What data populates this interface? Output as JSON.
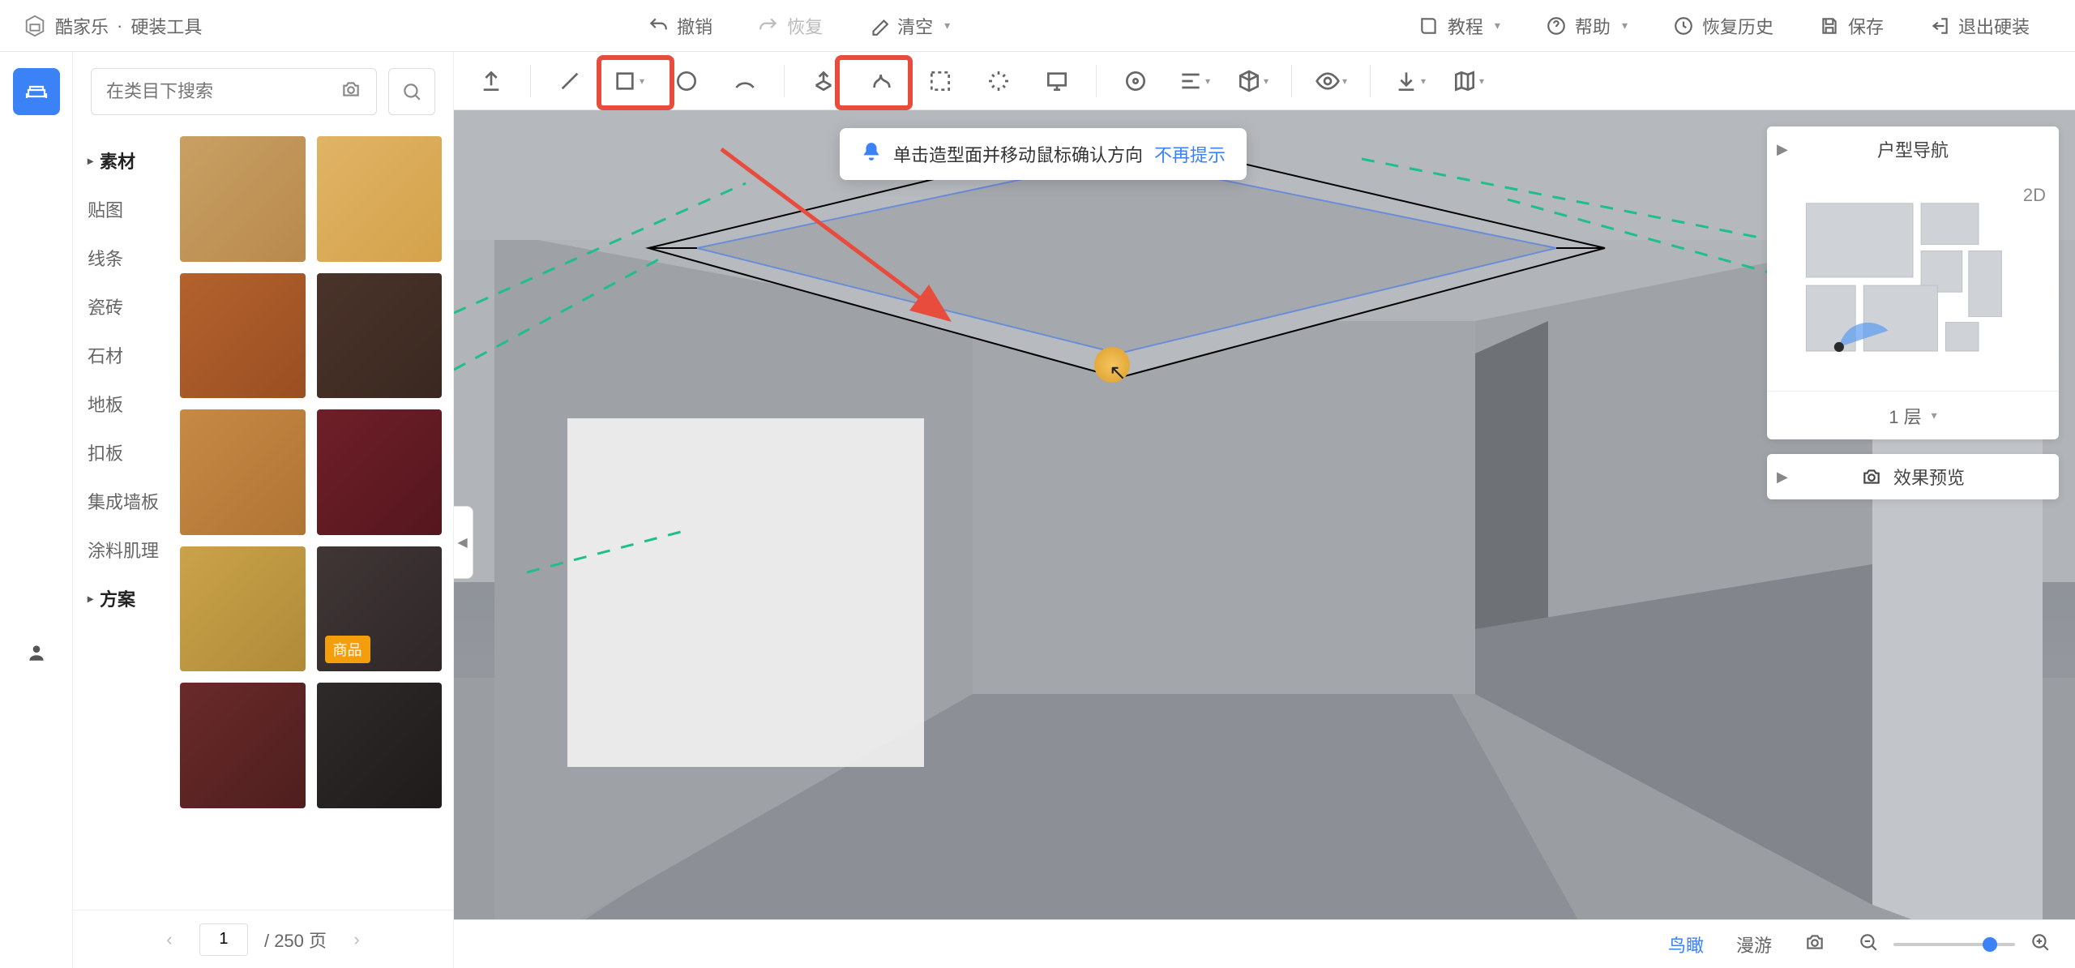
{
  "app": {
    "brand": "酷家乐",
    "module": "硬装工具"
  },
  "header": {
    "undo": "撤销",
    "redo": "恢复",
    "clear": "清空",
    "tutorial": "教程",
    "help": "帮助",
    "history": "恢复历史",
    "save": "保存",
    "exit": "退出硬装"
  },
  "search": {
    "placeholder": "在类目下搜索"
  },
  "cats": {
    "material": "素材",
    "items": [
      "贴图",
      "线条",
      "瓷砖",
      "石材",
      "地板",
      "扣板",
      "集成墙板",
      "涂料肌理"
    ],
    "plan": "方案"
  },
  "pager": {
    "page": "1",
    "total": "/ 250 页"
  },
  "tip": {
    "text": "单击造型面并移动鼠标确认方向",
    "link": "不再提示"
  },
  "right": {
    "nav_title": "户型导航",
    "minimap_badge": "2D",
    "floor": "1 层",
    "preview": "效果预览"
  },
  "bottom": {
    "bird": "鸟瞰",
    "roam": "漫游"
  },
  "thumb_tag": "商品",
  "thumbs": [
    "linear-gradient(135deg,#c9a063,#b8894d)",
    "linear-gradient(135deg,#e0b466,#d4a24a)",
    "linear-gradient(135deg,#b3622d,#9a4f22)",
    "linear-gradient(135deg,#4a342a,#3a2820)",
    "linear-gradient(135deg,#c78a45,#b07434)",
    "linear-gradient(135deg,#6f1f28,#55161e)",
    "linear-gradient(135deg,#caa24a,#b08b38)",
    "linear-gradient(135deg,#403636,#2f2728)",
    "linear-gradient(135deg,#6a2a2a,#4f1e1e)",
    "linear-gradient(135deg,#2e2a2a,#1f1b1b)"
  ]
}
